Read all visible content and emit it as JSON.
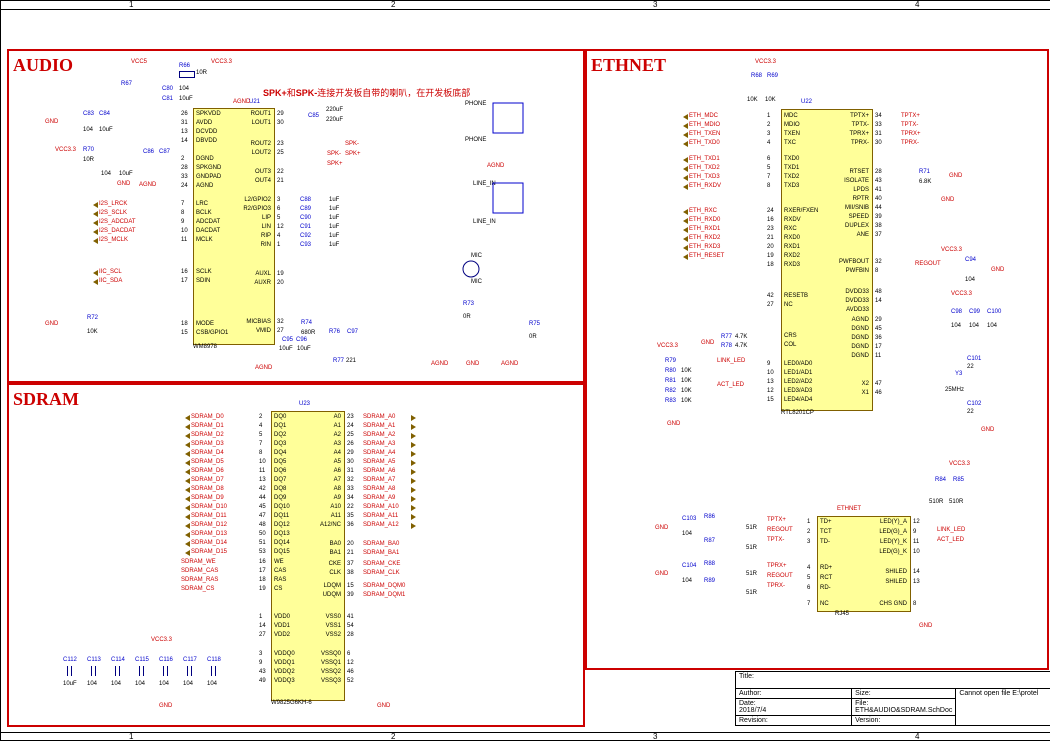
{
  "grid_cols": [
    "1",
    "2",
    "3",
    "4"
  ],
  "audio": {
    "title": "AUDIO",
    "ic_ref": "U21",
    "ic_part": "WM8978",
    "note": "SPK+和SPK-连接开发板自带的喇叭，在开发板底部",
    "left_pins": [
      {
        "num": "26",
        "name": "SPKVDD"
      },
      {
        "num": "31",
        "name": "AVDD"
      },
      {
        "num": "13",
        "name": "DCVDD"
      },
      {
        "num": "14",
        "name": "DBVDD"
      },
      {
        "num": "2",
        "name": "DGND"
      },
      {
        "num": "28",
        "name": "SPKGND"
      },
      {
        "num": "33",
        "name": "GNDPAD"
      },
      {
        "num": "24",
        "name": "AGND"
      },
      {
        "num": "7",
        "name": "LRC"
      },
      {
        "num": "8",
        "name": "BCLK"
      },
      {
        "num": "9",
        "name": "ADCDAT"
      },
      {
        "num": "10",
        "name": "DACDAT"
      },
      {
        "num": "11",
        "name": "MCLK"
      },
      {
        "num": "16",
        "name": "SCLK"
      },
      {
        "num": "17",
        "name": "SDIN"
      },
      {
        "num": "18",
        "name": "MODE"
      },
      {
        "num": "15",
        "name": "CSB/GPIO1"
      }
    ],
    "right_pins": [
      {
        "num": "29",
        "name": "ROUT1"
      },
      {
        "num": "30",
        "name": "LOUT1"
      },
      {
        "num": "23",
        "name": "ROUT2"
      },
      {
        "num": "25",
        "name": "LOUT2"
      },
      {
        "num": "22",
        "name": "OUT3"
      },
      {
        "num": "21",
        "name": "OUT4"
      },
      {
        "num": "3",
        "name": "L2/GPIO2"
      },
      {
        "num": "6",
        "name": "R2/GPIO3"
      },
      {
        "num": "5",
        "name": "LIP"
      },
      {
        "num": "12",
        "name": "LIN"
      },
      {
        "num": "4",
        "name": "RIP"
      },
      {
        "num": "1",
        "name": "RIN"
      },
      {
        "num": "19",
        "name": "AUXL"
      },
      {
        "num": "20",
        "name": "AUXR"
      },
      {
        "num": "32",
        "name": "MICBIAS"
      },
      {
        "num": "27",
        "name": "VMID"
      }
    ],
    "left_nets": [
      "I2S_LRCK",
      "I2S_SCLK",
      "I2S_ADCDAT",
      "I2S_DACDAT",
      "I2S_MCLK",
      "IIC_SCL",
      "IIC_SDA"
    ],
    "power": {
      "vcc5": "VCC5",
      "vcc33": "VCC3.3",
      "agnd": "AGND",
      "gnd": "GND"
    },
    "conn": [
      "PHONE",
      "PHONE",
      "LINE_IN",
      "LINE_IN",
      "MIC",
      "MIC"
    ],
    "spk": [
      "SPK-",
      "SPK+",
      "SPK-",
      "SPK+"
    ],
    "r": [
      {
        "ref": "R66",
        "val": "10R"
      },
      {
        "ref": "R67",
        "val": ""
      },
      {
        "ref": "R70",
        "val": "10R"
      },
      {
        "ref": "R72",
        "val": "10K"
      },
      {
        "ref": "R73",
        "val": "0R"
      },
      {
        "ref": "R74",
        "val": "680R"
      },
      {
        "ref": "R75",
        "val": "0R"
      },
      {
        "ref": "R76",
        "val": ""
      },
      {
        "ref": "R77",
        "val": "221"
      }
    ],
    "c": [
      {
        "ref": "C80",
        "val": "104"
      },
      {
        "ref": "C81",
        "val": "10uF"
      },
      {
        "ref": "C83",
        "val": "104"
      },
      {
        "ref": "C84",
        "val": "10uF"
      },
      {
        "ref": "C85",
        "val": "220uF"
      },
      {
        "ref": "C86",
        "val": "104"
      },
      {
        "ref": "C87",
        "val": "10uF"
      },
      {
        "ref": "C88",
        "val": "1uF"
      },
      {
        "ref": "C89",
        "val": "1uF"
      },
      {
        "ref": "C90",
        "val": "1uF"
      },
      {
        "ref": "C91",
        "val": "1uF"
      },
      {
        "ref": "C92",
        "val": "1uF"
      },
      {
        "ref": "C93",
        "val": "1uF"
      },
      {
        "ref": "C95",
        "val": "10uF"
      },
      {
        "ref": "C96",
        "val": "10uF"
      },
      {
        "ref": "C97",
        "val": ""
      }
    ],
    "extra_val_220uF": "220uF"
  },
  "sdram": {
    "title": "SDRAM",
    "ic_ref": "U23",
    "ic_part": "W9825G6KH-6",
    "d_nets": [
      "SDRAM_D0",
      "SDRAM_D1",
      "SDRAM_D2",
      "SDRAM_D3",
      "SDRAM_D4",
      "SDRAM_D5",
      "SDRAM_D6",
      "SDRAM_D7",
      "SDRAM_D8",
      "SDRAM_D9",
      "SDRAM_D10",
      "SDRAM_D11",
      "SDRAM_D12",
      "SDRAM_D13",
      "SDRAM_D14",
      "SDRAM_D15"
    ],
    "a_nets": [
      "SDRAM_A0",
      "SDRAM_A1",
      "SDRAM_A2",
      "SDRAM_A3",
      "SDRAM_A4",
      "SDRAM_A5",
      "SDRAM_A6",
      "SDRAM_A7",
      "SDRAM_A8",
      "SDRAM_A9",
      "SDRAM_A10",
      "SDRAM_A11",
      "SDRAM_A12"
    ],
    "ctrl_nets_l": [
      "SDRAM_WE",
      "SDRAM_CAS",
      "SDRAM_RAS",
      "SDRAM_CS"
    ],
    "ctrl_nets_r": [
      "SDRAM_BA0",
      "SDRAM_BA1",
      "SDRAM_CKE",
      "SDRAM_CLK",
      "SDRAM_DQM0",
      "SDRAM_DQM1"
    ],
    "left_pins": [
      {
        "num": "2",
        "name": "DQ0"
      },
      {
        "num": "4",
        "name": "DQ1"
      },
      {
        "num": "5",
        "name": "DQ2"
      },
      {
        "num": "7",
        "name": "DQ3"
      },
      {
        "num": "8",
        "name": "DQ4"
      },
      {
        "num": "10",
        "name": "DQ5"
      },
      {
        "num": "11",
        "name": "DQ6"
      },
      {
        "num": "13",
        "name": "DQ7"
      },
      {
        "num": "42",
        "name": "DQ8"
      },
      {
        "num": "44",
        "name": "DQ9"
      },
      {
        "num": "45",
        "name": "DQ10"
      },
      {
        "num": "47",
        "name": "DQ11"
      },
      {
        "num": "48",
        "name": "DQ12"
      },
      {
        "num": "50",
        "name": "DQ13"
      },
      {
        "num": "51",
        "name": "DQ14"
      },
      {
        "num": "53",
        "name": "DQ15"
      },
      {
        "num": "16",
        "name": "WE"
      },
      {
        "num": "17",
        "name": "CAS"
      },
      {
        "num": "18",
        "name": "RAS"
      },
      {
        "num": "19",
        "name": "CS"
      },
      {
        "num": "1",
        "name": "VDD0"
      },
      {
        "num": "14",
        "name": "VDD1"
      },
      {
        "num": "27",
        "name": "VDD2"
      },
      {
        "num": "3",
        "name": "VDDQ0"
      },
      {
        "num": "9",
        "name": "VDDQ1"
      },
      {
        "num": "43",
        "name": "VDDQ2"
      },
      {
        "num": "49",
        "name": "VDDQ3"
      }
    ],
    "right_pins": [
      {
        "num": "23",
        "name": "A0"
      },
      {
        "num": "24",
        "name": "A1"
      },
      {
        "num": "25",
        "name": "A2"
      },
      {
        "num": "26",
        "name": "A3"
      },
      {
        "num": "29",
        "name": "A4"
      },
      {
        "num": "30",
        "name": "A5"
      },
      {
        "num": "31",
        "name": "A6"
      },
      {
        "num": "32",
        "name": "A7"
      },
      {
        "num": "33",
        "name": "A8"
      },
      {
        "num": "34",
        "name": "A9"
      },
      {
        "num": "22",
        "name": "A10"
      },
      {
        "num": "35",
        "name": "A11"
      },
      {
        "num": "36",
        "name": "A12/NC"
      },
      {
        "num": "20",
        "name": "BA0"
      },
      {
        "num": "21",
        "name": "BA1"
      },
      {
        "num": "37",
        "name": "CKE"
      },
      {
        "num": "38",
        "name": "CLK"
      },
      {
        "num": "15",
        "name": "LDQM"
      },
      {
        "num": "39",
        "name": "UDQM"
      },
      {
        "num": "41",
        "name": "VSS0"
      },
      {
        "num": "54",
        "name": "VSS1"
      },
      {
        "num": "28",
        "name": "VSS2"
      },
      {
        "num": "6",
        "name": "VSSQ0"
      },
      {
        "num": "12",
        "name": "VSSQ1"
      },
      {
        "num": "46",
        "name": "VSSQ2"
      },
      {
        "num": "52",
        "name": "VSSQ3"
      }
    ],
    "caps": [
      "C112",
      "C113",
      "C114",
      "C115",
      "C116",
      "C117",
      "C118"
    ],
    "cap_vals_top": [
      "10uF",
      "104",
      "104",
      "104",
      "104",
      "104",
      "104"
    ],
    "vcc": "VCC3.3"
  },
  "ethnet": {
    "title": "ETHNET",
    "ic_ref": "U22",
    "ic_part": "RTL8201CP",
    "left_nets": [
      "ETH_MDC",
      "ETH_MDIO",
      "ETH_TXEN",
      "",
      "ETH_TXD0",
      "ETH_TXD1",
      "ETH_TXD2",
      "ETH_TXD3",
      "",
      "ETH_RXDV",
      "ETH_RXC",
      "ETH_RXD0",
      "ETH_RXD1",
      "ETH_RXD2",
      "ETH_RXD3",
      "",
      "ETH_RESET"
    ],
    "left_pins": [
      {
        "num": "1",
        "name": "MDC"
      },
      {
        "num": "2",
        "name": "MDIO"
      },
      {
        "num": "3",
        "name": "TXEN"
      },
      {
        "num": "4",
        "name": "TXC"
      },
      {
        "num": "6",
        "name": "TXD0"
      },
      {
        "num": "5",
        "name": "TXD1"
      },
      {
        "num": "7",
        "name": "TXD2"
      },
      {
        "num": "8",
        "name": "TXD3"
      },
      {
        "num": "24",
        "name": "RXER/FXEN"
      },
      {
        "num": "16",
        "name": "RXDV"
      },
      {
        "num": "23",
        "name": "RXC"
      },
      {
        "num": "21",
        "name": "RXD0"
      },
      {
        "num": "20",
        "name": "RXD1"
      },
      {
        "num": "19",
        "name": "RXD2"
      },
      {
        "num": "18",
        "name": "RXD3"
      },
      {
        "num": "42",
        "name": "RESETB"
      },
      {
        "num": "27",
        "name": "NC"
      },
      {
        "num": "",
        "name": "CRS"
      },
      {
        "num": "",
        "name": "COL"
      },
      {
        "num": "9",
        "name": "LED0/AD0"
      },
      {
        "num": "10",
        "name": "LED1/AD1"
      },
      {
        "num": "13",
        "name": "LED2/AD2"
      },
      {
        "num": "12",
        "name": "LED3/AD3"
      },
      {
        "num": "15",
        "name": "LED4/AD4"
      }
    ],
    "right_pins": [
      {
        "num": "34",
        "name": "TPTX+"
      },
      {
        "num": "33",
        "name": "TPTX-"
      },
      {
        "num": "31",
        "name": "TPRX+"
      },
      {
        "num": "30",
        "name": "TPRX-"
      },
      {
        "num": "28",
        "name": "RTSET"
      },
      {
        "num": "43",
        "name": "ISOLATE"
      },
      {
        "num": "41",
        "name": "LPDS"
      },
      {
        "num": "40",
        "name": "RPTR"
      },
      {
        "num": "44",
        "name": "MII/SNIB"
      },
      {
        "num": "39",
        "name": "SPEED"
      },
      {
        "num": "38",
        "name": "DUPLEX"
      },
      {
        "num": "37",
        "name": "ANE"
      },
      {
        "num": "32",
        "name": "PWFBOUT"
      },
      {
        "num": "8",
        "name": "PWFBIN"
      },
      {
        "num": "48",
        "name": "DVDD33"
      },
      {
        "num": "14",
        "name": "DVDD33"
      },
      {
        "num": "",
        "name": "AVDD33"
      },
      {
        "num": "29",
        "name": "AGND"
      },
      {
        "num": "45",
        "name": "DGND"
      },
      {
        "num": "36",
        "name": "DGND"
      },
      {
        "num": "17",
        "name": "DGND"
      },
      {
        "num": "11",
        "name": "DGND"
      },
      {
        "num": "47",
        "name": "X2"
      },
      {
        "num": "46",
        "name": "X1"
      }
    ],
    "right_nets": [
      "TPTX+",
      "TPTX-",
      "TPRX+",
      "TPRX-"
    ],
    "r": [
      {
        "ref": "R68",
        "val": "10K"
      },
      {
        "ref": "R69",
        "val": "10K"
      },
      {
        "ref": "R71",
        "val": "6.8K"
      },
      {
        "ref": "R77",
        "val": "4.7K"
      },
      {
        "ref": "R78",
        "val": "4.7K"
      },
      {
        "ref": "R79",
        "val": ""
      },
      {
        "ref": "R80",
        "val": "10K"
      },
      {
        "ref": "R81",
        "val": "10K"
      },
      {
        "ref": "R82",
        "val": "10K"
      },
      {
        "ref": "R83",
        "val": "10K"
      },
      {
        "ref": "R84",
        "val": "510R"
      },
      {
        "ref": "R85",
        "val": "510R"
      },
      {
        "ref": "R86",
        "val": "51R"
      },
      {
        "ref": "R87",
        "val": "51R"
      },
      {
        "ref": "R88",
        "val": "51R"
      },
      {
        "ref": "R89",
        "val": "51R"
      }
    ],
    "c": [
      {
        "ref": "C94",
        "val": "104"
      },
      {
        "ref": "C98",
        "val": "104"
      },
      {
        "ref": "C99",
        "val": "104"
      },
      {
        "ref": "C100",
        "val": "104"
      },
      {
        "ref": "C101",
        "val": "22"
      },
      {
        "ref": "C102",
        "val": "22"
      },
      {
        "ref": "C103",
        "val": "104"
      },
      {
        "ref": "C104",
        "val": "104"
      }
    ],
    "xtal": {
      "ref": "Y3",
      "val": "25MHz"
    },
    "led_nets": [
      "LINK_LED",
      "ACT_LED"
    ],
    "regout": "REGOUT",
    "vcc": "VCC3.3",
    "rj45": {
      "ref": "RJ45",
      "title": "ETHNET",
      "left_pins": [
        {
          "num": "1",
          "name": "TD+"
        },
        {
          "num": "2",
          "name": "TCT"
        },
        {
          "num": "3",
          "name": "TD-"
        },
        {
          "num": "4",
          "name": "RD+"
        },
        {
          "num": "5",
          "name": "RCT"
        },
        {
          "num": "6",
          "name": "RD-"
        },
        {
          "num": "7",
          "name": "NC"
        }
      ],
      "right_pins": [
        {
          "num": "12",
          "name": "LED(Y)_A"
        },
        {
          "num": "9",
          "name": "LED(G)_A"
        },
        {
          "num": "11",
          "name": "LED(Y)_K"
        },
        {
          "num": "10",
          "name": "LED(G)_K"
        },
        {
          "num": "14",
          "name": "SHILED"
        },
        {
          "num": "13",
          "name": "SHILED"
        },
        {
          "num": "8",
          "name": "CHS GND"
        }
      ],
      "in_nets": [
        "TPTX+",
        "REGOUT",
        "TPTX-",
        "TPRX+",
        "REGOUT",
        "TPRX-"
      ],
      "out_nets": [
        "LINK_LED",
        "ACT_LED"
      ]
    }
  },
  "titleblock": {
    "title_label": "Title:",
    "author_label": "Author:",
    "size_label": "Size:",
    "date_label": "Date:",
    "date": "2018/7/4",
    "file_label": "File:",
    "file": "ETH&AUDIO&SDRAM.SchDoc",
    "rev_label": "Revision:",
    "ver_label": "Version:",
    "err": "Cannot open file E:\\protel"
  }
}
